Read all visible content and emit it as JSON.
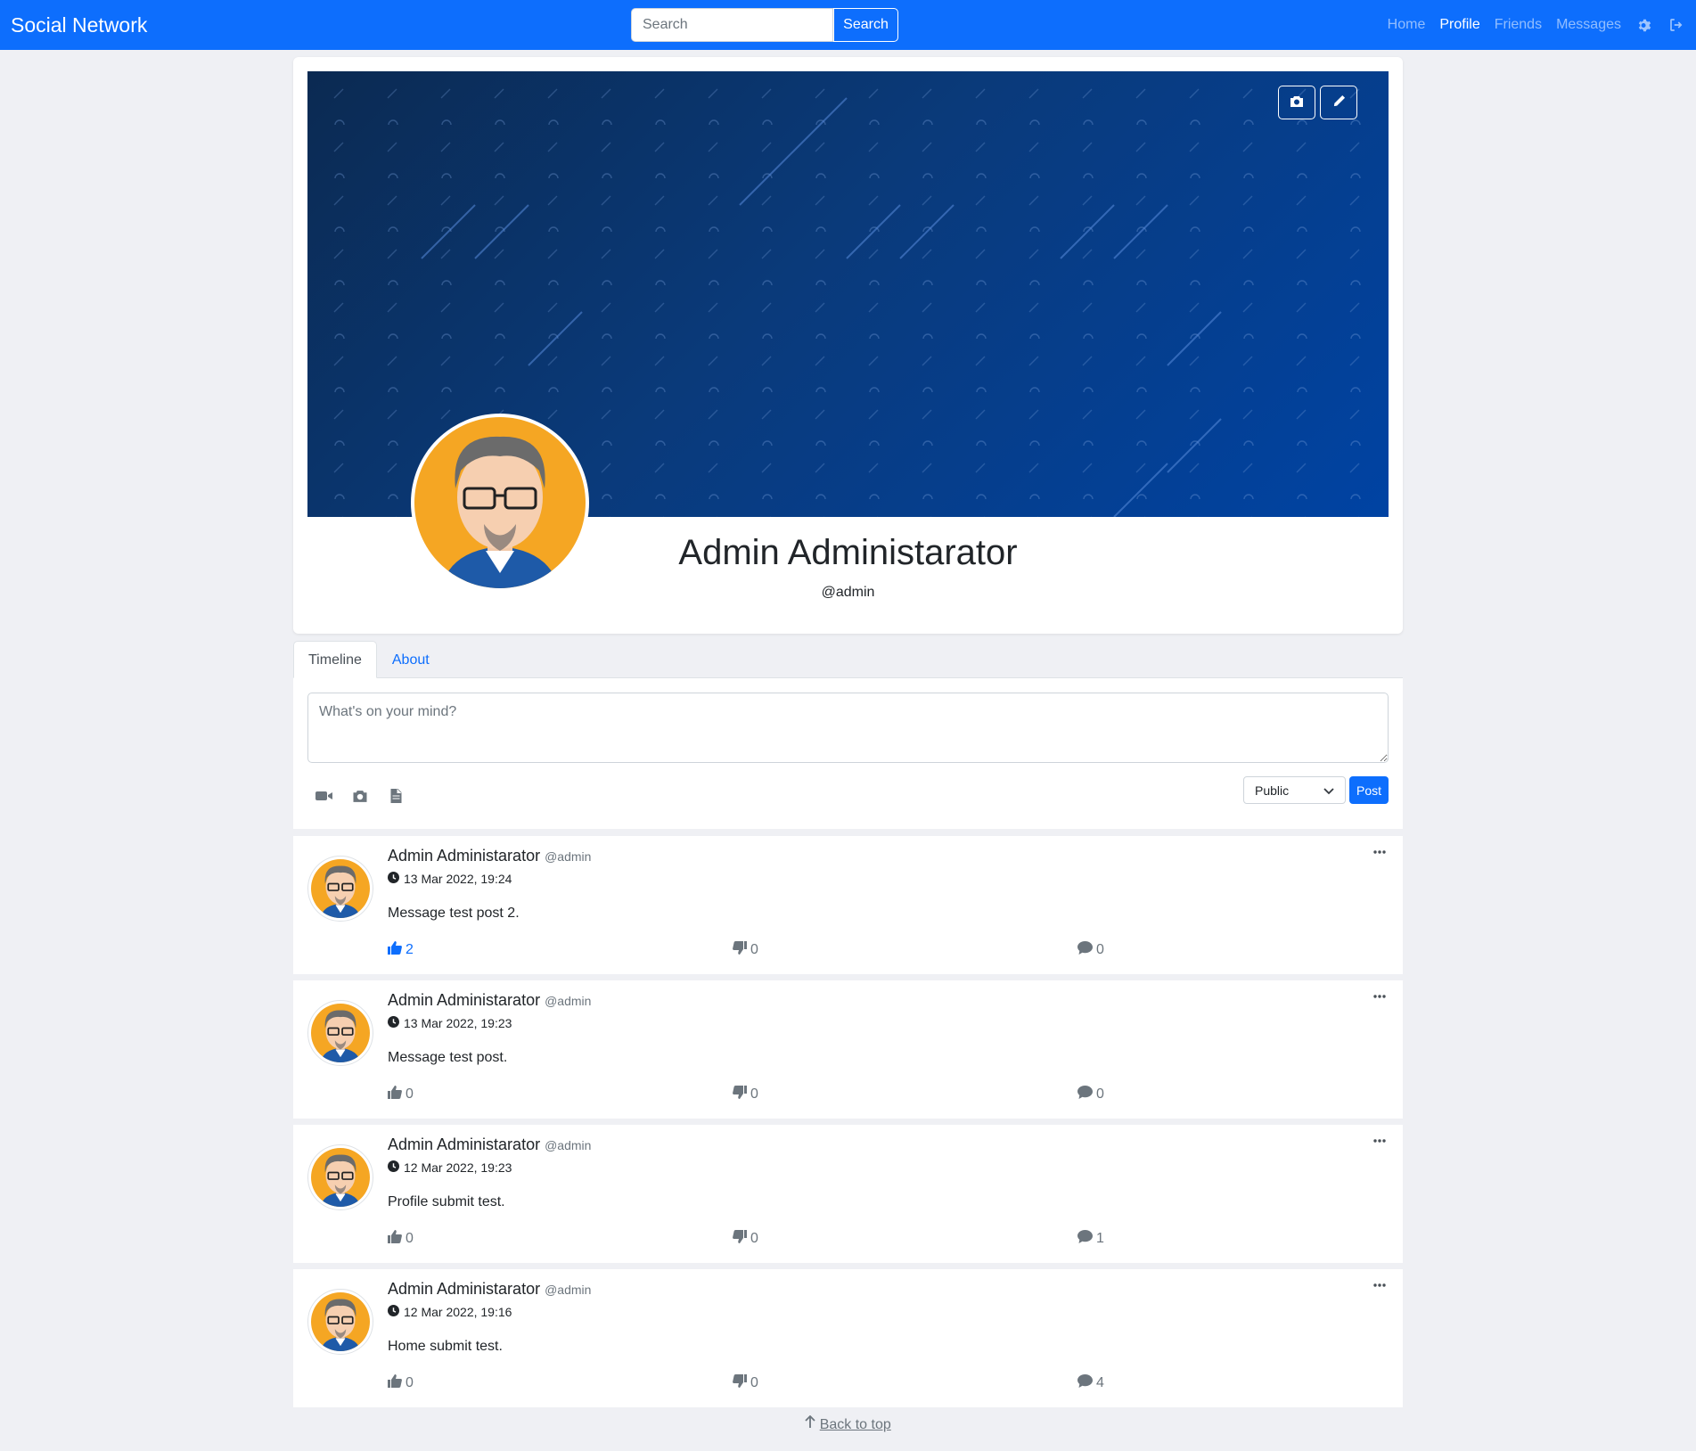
{
  "navbar": {
    "brand": "Social Network",
    "search_placeholder": "Search",
    "search_button": "Search",
    "links": [
      "Home",
      "Profile",
      "Friends",
      "Messages"
    ],
    "active_link": "Profile",
    "settings_icon": "gear-icon",
    "logout_icon": "logout-icon"
  },
  "profile": {
    "name": "Admin Administarator",
    "handle": "@admin",
    "cover_buttons": [
      "camera-icon",
      "pencil-icon"
    ]
  },
  "tabs": [
    {
      "label": "Timeline",
      "active": true
    },
    {
      "label": "About",
      "active": false
    }
  ],
  "composer": {
    "placeholder": "What's on your mind?",
    "icons": [
      "video-icon",
      "camera-icon",
      "file-icon"
    ],
    "privacy": "Public",
    "post_button": "Post"
  },
  "posts": [
    {
      "author": "Admin Administarator",
      "handle": "@admin",
      "time": "13 Mar 2022, 19:24",
      "body": "Message test post 2.",
      "likes": "2",
      "liked": true,
      "dislikes": "0",
      "comments": "0"
    },
    {
      "author": "Admin Administarator",
      "handle": "@admin",
      "time": "13 Mar 2022, 19:23",
      "body": "Message test post.",
      "likes": "0",
      "liked": false,
      "dislikes": "0",
      "comments": "0"
    },
    {
      "author": "Admin Administarator",
      "handle": "@admin",
      "time": "12 Mar 2022, 19:23",
      "body": "Profile submit test.",
      "likes": "0",
      "liked": false,
      "dislikes": "0",
      "comments": "1"
    },
    {
      "author": "Admin Administarator",
      "handle": "@admin",
      "time": "12 Mar 2022, 19:16",
      "body": "Home submit test.",
      "likes": "0",
      "liked": false,
      "dislikes": "0",
      "comments": "4"
    }
  ],
  "footer": {
    "back_to_top": " Back to top"
  },
  "colors": {
    "primary": "#0d6efd",
    "page_bg": "#eff0f4",
    "muted": "#6c757d",
    "cover_dark": "#0b2a52",
    "cover_light": "#0043a3"
  }
}
